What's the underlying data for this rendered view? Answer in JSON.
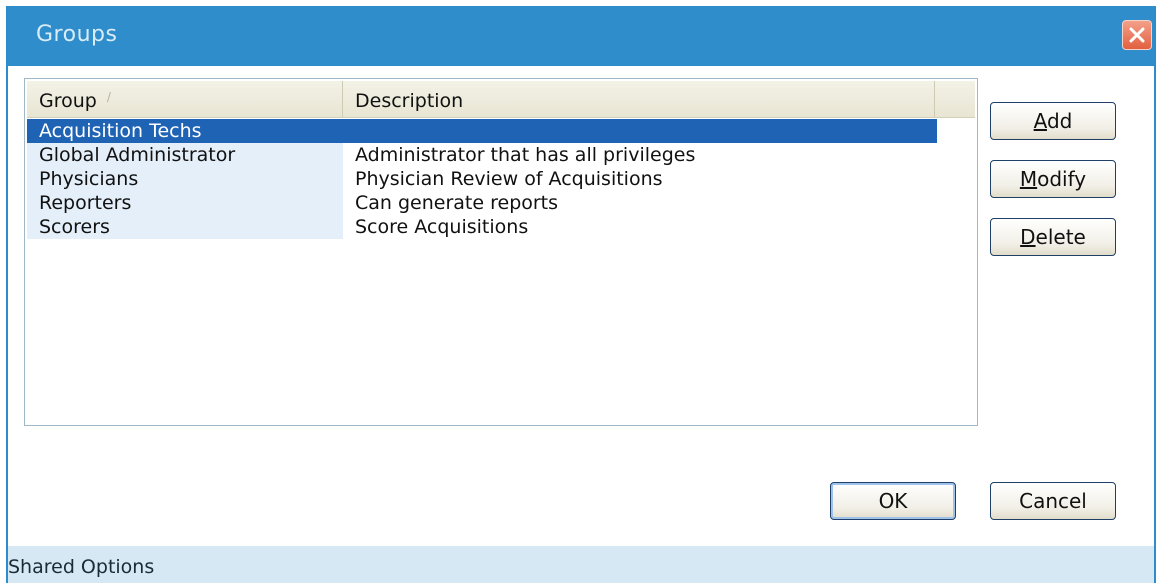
{
  "window": {
    "title": "Groups",
    "close_icon": "close-x-icon"
  },
  "listview": {
    "columns": {
      "group": "Group",
      "description": "Description"
    },
    "rows": [
      {
        "group": "Acquisition Techs",
        "description": "",
        "selected": true
      },
      {
        "group": "Global Administrator",
        "description": "Administrator that has all privileges",
        "selected": false
      },
      {
        "group": "Physicians",
        "description": "Physician Review of Acquisitions",
        "selected": false
      },
      {
        "group": "Reporters",
        "description": "Can generate reports",
        "selected": false
      },
      {
        "group": "Scorers",
        "description": "Score Acquisitions",
        "selected": false
      }
    ]
  },
  "actions": {
    "add": {
      "mnemonic": "A",
      "rest": "dd"
    },
    "modify": {
      "mnemonic": "M",
      "rest": "odify"
    },
    "delete": {
      "mnemonic": "D",
      "rest": "elete"
    },
    "ok": "OK",
    "cancel": "Cancel"
  },
  "status": {
    "text": "Shared Options"
  },
  "colors": {
    "titlebar": "#2f8dcb",
    "selection": "#1f63b5",
    "status_bar": "#d6e8f3",
    "close_button": "#e2603f"
  }
}
